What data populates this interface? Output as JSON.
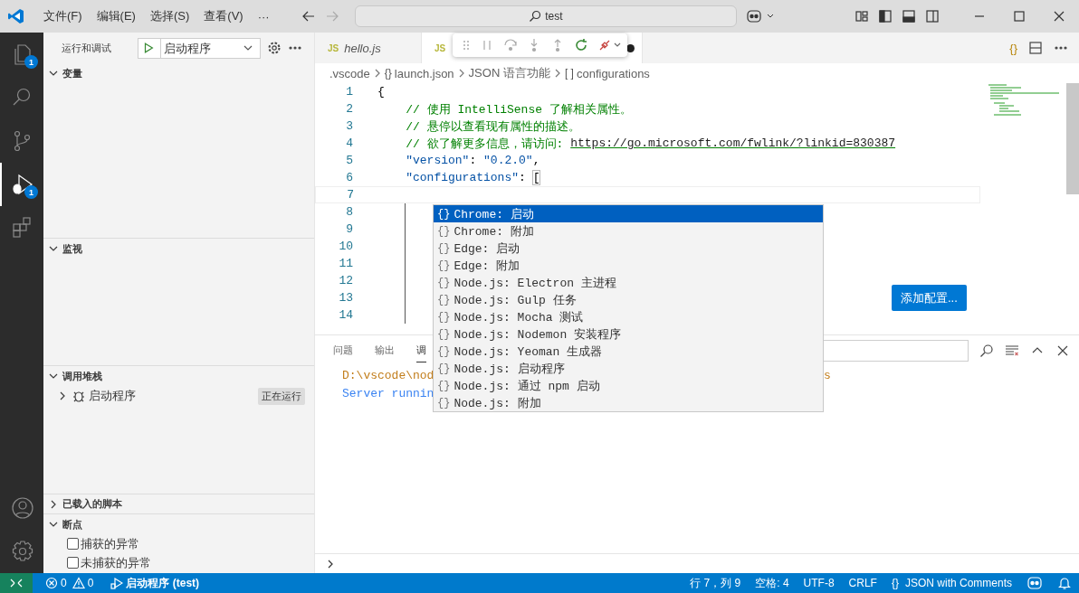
{
  "title_bar": {
    "menus": [
      "文件(F)",
      "编辑(E)",
      "选择(S)",
      "查看(V)"
    ],
    "more": "···",
    "command_center": "test"
  },
  "activity_bar": {
    "items": [
      {
        "kind": "files",
        "badge": "1",
        "selected": false
      },
      {
        "kind": "search",
        "selected": false
      },
      {
        "kind": "source_control",
        "selected": false
      },
      {
        "kind": "run_debug",
        "badge": "1",
        "selected": true
      },
      {
        "kind": "extensions",
        "selected": false
      }
    ],
    "bottom": [
      {
        "kind": "account"
      },
      {
        "kind": "settings"
      }
    ]
  },
  "sidebar": {
    "title": "运行和调试",
    "config": "启动程序",
    "sections": [
      {
        "kind": "variables",
        "title": "变量",
        "expanded": true
      },
      {
        "kind": "watch",
        "title": "监视",
        "expanded": true
      },
      {
        "kind": "call_stack",
        "title": "调用堆栈",
        "expanded": true,
        "items": [
          {
            "label": "启动程序",
            "badge": "正在运行",
            "expanded": false
          }
        ]
      },
      {
        "kind": "scripts",
        "title": "已载入的脚本",
        "expanded": false
      },
      {
        "kind": "breakpoints",
        "title": "断点",
        "expanded": true,
        "items": [
          {
            "label": "捕获的异常",
            "checked": false
          },
          {
            "label": "未捕获的异常",
            "checked": false
          }
        ]
      }
    ]
  },
  "tabs": [
    {
      "icon": "JS",
      "label": "hello.js",
      "selected": false,
      "dirty": false
    },
    {
      "icon": "JS",
      "selected": true,
      "dirty": true
    }
  ],
  "breadcrumbs": [
    {
      "label": ".vscode"
    },
    {
      "icon": "{}",
      "label": "launch.json"
    },
    {
      "label": "JSON 语言功能"
    },
    {
      "icon": "[ ]",
      "label": "configurations"
    }
  ],
  "code_lines": [
    {
      "number": "1",
      "tokens": [
        {
          "kind": "text",
          "text": "{"
        }
      ]
    },
    {
      "number": "2",
      "tokens": [
        {
          "kind": "comment",
          "text": "    // 使用 IntelliSense 了解相关属性。"
        }
      ]
    },
    {
      "number": "3",
      "tokens": [
        {
          "kind": "comment",
          "text": "    // 悬停以查看现有属性的描述。"
        }
      ]
    },
    {
      "number": "4",
      "tokens": [
        {
          "kind": "comment",
          "text": "    // 欲了解更多信息，请访问: "
        },
        {
          "kind": "link",
          "text": "https://go.microsoft.com/fwlink/?linkid=830387"
        }
      ]
    },
    {
      "number": "5",
      "tokens": [
        {
          "kind": "key",
          "text": "    \"version\""
        },
        {
          "kind": "text",
          "text": ": "
        },
        {
          "kind": "string",
          "text": "\"0.2.0\""
        },
        {
          "kind": "text",
          "text": ","
        }
      ]
    },
    {
      "number": "6",
      "tokens": [
        {
          "kind": "key",
          "text": "    \"configurations\""
        },
        {
          "kind": "text",
          "text": ": "
        },
        {
          "kind": "bracket",
          "text": "["
        }
      ]
    },
    {
      "number": "7",
      "current": true
    },
    {
      "number": "8",
      "indent_guide": true
    },
    {
      "number": "9",
      "indent_guide": true
    },
    {
      "number": "10",
      "indent_guide": true
    },
    {
      "number": "11",
      "indent_guide": true
    },
    {
      "number": "12",
      "indent_guide": true
    },
    {
      "number": "13",
      "indent_guide": true
    },
    {
      "number": "14",
      "indent_guide": true
    }
  ],
  "suggestions": [
    {
      "icon": "{}",
      "label": "Chrome: 启动",
      "selected": true
    },
    {
      "icon": "{}",
      "label": "Chrome: 附加",
      "selected": false
    },
    {
      "icon": "{}",
      "label": "Edge: 启动",
      "selected": false
    },
    {
      "icon": "{}",
      "label": "Edge: 附加",
      "selected": false
    },
    {
      "icon": "{}",
      "label": "Node.js: Electron 主进程",
      "selected": false
    },
    {
      "icon": "{}",
      "label": "Node.js: Gulp 任务",
      "selected": false
    },
    {
      "icon": "{}",
      "label": "Node.js: Mocha 测试",
      "selected": false
    },
    {
      "icon": "{}",
      "label": "Node.js: Nodemon 安装程序",
      "selected": false
    },
    {
      "icon": "{}",
      "label": "Node.js: Yeoman 生成器",
      "selected": false
    },
    {
      "icon": "{}",
      "label": "Node.js: 启动程序",
      "selected": false
    },
    {
      "icon": "{}",
      "label": "Node.js: 通过 npm 启动",
      "selected": false
    },
    {
      "icon": "{}",
      "label": "Node.js: 附加",
      "selected": false
    }
  ],
  "add_config_button": "添加配置...",
  "panel": {
    "tabs": [
      {
        "label": "问题",
        "selected": false
      },
      {
        "label": "输出",
        "selected": false
      },
      {
        "label": "调",
        "selected": true
      }
    ],
    "output": [
      {
        "kind": "path",
        "text": "D:\\vscode\\nod",
        "tail": "s"
      },
      {
        "kind": "info",
        "text": "Server runnin"
      }
    ]
  },
  "status_bar": {
    "errors": "0",
    "warnings": "0",
    "debug": "启动程序 (test)",
    "right": [
      "行 7，列 9",
      "空格: 4",
      "UTF-8",
      "CRLF"
    ],
    "language_icon": "{}",
    "language": "JSON with Comments"
  }
}
